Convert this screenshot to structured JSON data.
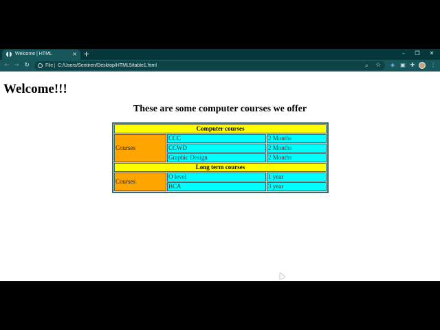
{
  "browser": {
    "tab_title": "Welcome | HTML",
    "tab_close": "×",
    "new_tab": "+",
    "window_controls": {
      "minimize": "–",
      "restore": "❐",
      "close": "✕"
    },
    "nav": {
      "back": "←",
      "forward": "→",
      "reload": "↻"
    },
    "omnibox": {
      "scheme_label": "File",
      "url": "C:/Users/Sentiren/Desktop/HTML5/table1.html"
    },
    "menu": "⋮"
  },
  "page": {
    "heading": "Welcome!!!",
    "subheading": "These are some computer courses we offer"
  },
  "table": {
    "sections": [
      {
        "title": "Computer courses",
        "label": "Courses",
        "rows": [
          {
            "name": "CCC",
            "duration": "2 Months"
          },
          {
            "name": "CCWD",
            "duration": "2 Months"
          },
          {
            "name": "Graphic Design",
            "duration": "2 Months"
          }
        ]
      },
      {
        "title": "Long term courses",
        "label": "Courses",
        "rows": [
          {
            "name": "O level",
            "duration": "1 year"
          },
          {
            "name": "BCA",
            "duration": "3 year"
          }
        ]
      }
    ]
  },
  "colors": {
    "section_header": "#ffff00",
    "label_cell": "#ffa500",
    "data_cell": "#00ffff",
    "browser_frame": "#17565a"
  }
}
